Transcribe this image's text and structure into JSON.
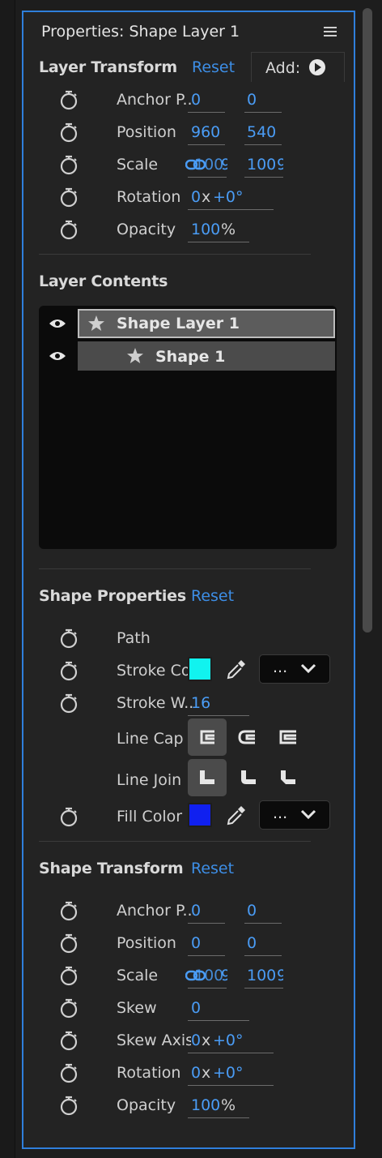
{
  "panel": {
    "title": "Properties: Shape Layer 1",
    "menu_icon": "hamburger-menu-icon"
  },
  "layer_transform": {
    "heading": "Layer Transform",
    "reset": "Reset",
    "add": "Add:",
    "anchor": {
      "label": "Anchor P..",
      "x": "0",
      "y": "0"
    },
    "position": {
      "label": "Position",
      "x": "960",
      "y": "540"
    },
    "scale": {
      "label": "Scale",
      "x": "100",
      "y": "100",
      "xunit": "9",
      "yunit": "9"
    },
    "rotation": {
      "label": "Rotation",
      "rev": "0",
      "x": "x",
      "deg": "+0°"
    },
    "opacity": {
      "label": "Opacity",
      "value": "100",
      "unit": "%"
    }
  },
  "layer_contents": {
    "heading": "Layer Contents",
    "items": [
      {
        "label": "Shape Layer 1"
      },
      {
        "label": "Shape 1"
      }
    ]
  },
  "shape_properties": {
    "heading": "Shape Properties",
    "reset": "Reset",
    "path": {
      "label": "Path"
    },
    "stroke_color": {
      "label": "Stroke Co",
      "color": "#11f3ef",
      "dropdown": "..."
    },
    "stroke_width": {
      "label": "Stroke W..",
      "value": "16"
    },
    "line_cap": {
      "label": "Line Cap"
    },
    "line_join": {
      "label": "Line Join"
    },
    "fill_color": {
      "label": "Fill Color",
      "color": "#1020f0",
      "dropdown": "..."
    }
  },
  "shape_transform": {
    "heading": "Shape Transform",
    "reset": "Reset",
    "anchor": {
      "label": "Anchor P..",
      "x": "0",
      "y": "0"
    },
    "position": {
      "label": "Position",
      "x": "0",
      "y": "0"
    },
    "scale": {
      "label": "Scale",
      "x": "100",
      "y": "100",
      "xunit": "9",
      "yunit": "9"
    },
    "skew": {
      "label": "Skew",
      "value": "0"
    },
    "skew_axis": {
      "label": "Skew Axis",
      "rev": "0",
      "x": "x",
      "deg": "+0°"
    },
    "rotation": {
      "label": "Rotation",
      "rev": "0",
      "x": "x",
      "deg": "+0°"
    },
    "opacity": {
      "label": "Opacity",
      "value": "100",
      "unit": "%"
    }
  }
}
